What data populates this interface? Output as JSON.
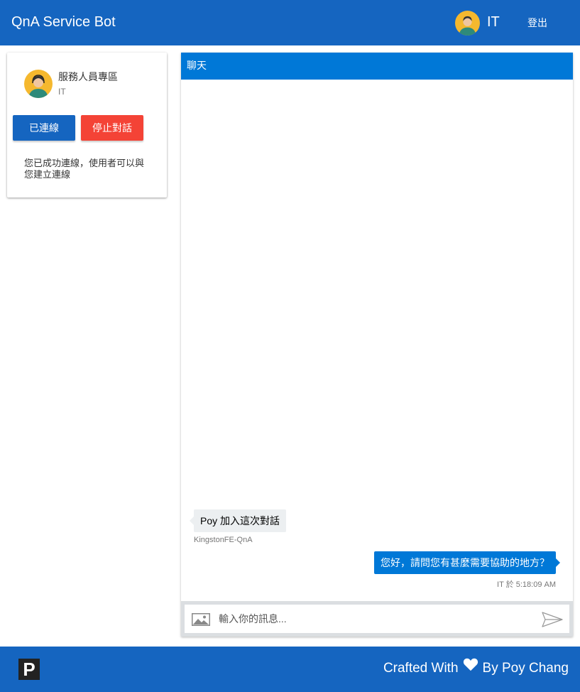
{
  "header": {
    "title": "QnA Service Bot",
    "user_name": "IT",
    "logout_label": "登出",
    "accent": "#1565c0"
  },
  "agent_card": {
    "title": "服務人員專區",
    "subtitle": "IT",
    "connected_label": "已連線",
    "stop_label": "停止對話",
    "status_message": "您已成功連線，使用者可以與您建立連線",
    "connected_color": "#1565c0",
    "stop_color": "#f44336"
  },
  "chat": {
    "header": "聊天",
    "messages": [
      {
        "direction": "incoming",
        "text": "Poy 加入這次對話",
        "meta": "KingstonFE-QnA"
      },
      {
        "direction": "outgoing",
        "text": "您好，請問您有甚麼需要協助的地方？",
        "meta": "IT 於 5:18:09 AM"
      }
    ],
    "input_placeholder": "輸入你的訊息...",
    "icons": {
      "attach": "image-icon",
      "send": "send-icon"
    }
  },
  "footer": {
    "logo_letter": "P",
    "credit_prefix": "Crafted With",
    "credit_suffix": "By Poy Chang",
    "heart_icon": "heart-icon"
  }
}
